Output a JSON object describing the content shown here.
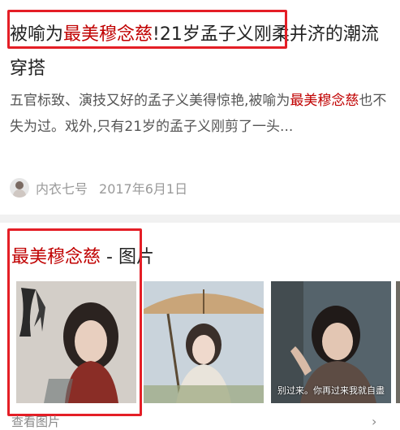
{
  "result1": {
    "title_part1": "被喻为",
    "title_highlight": "最美穆念慈",
    "title_part2": "!21岁孟子义刚柔并济的潮流穿搭",
    "snippet_part1": "五官标致、演技又好的孟子义美得惊艳,被喻为",
    "snippet_highlight": "最美穆念慈",
    "snippet_part2": "也不失为过。戏外,只有21岁的孟子义刚剪了一头...",
    "source": "内衣七号",
    "date": "2017年6月1日"
  },
  "images_section": {
    "title_highlight": "最美穆念慈",
    "title_suffix": " - 图片",
    "thumb3_caption": "别过来。你再过来我就自盡",
    "more_label": "查看图片",
    "more_icon": "chevron-right-icon"
  },
  "colors": {
    "highlight": "#c00000",
    "annotation_box": "#e41e26",
    "divider": "#f1f1f1"
  }
}
